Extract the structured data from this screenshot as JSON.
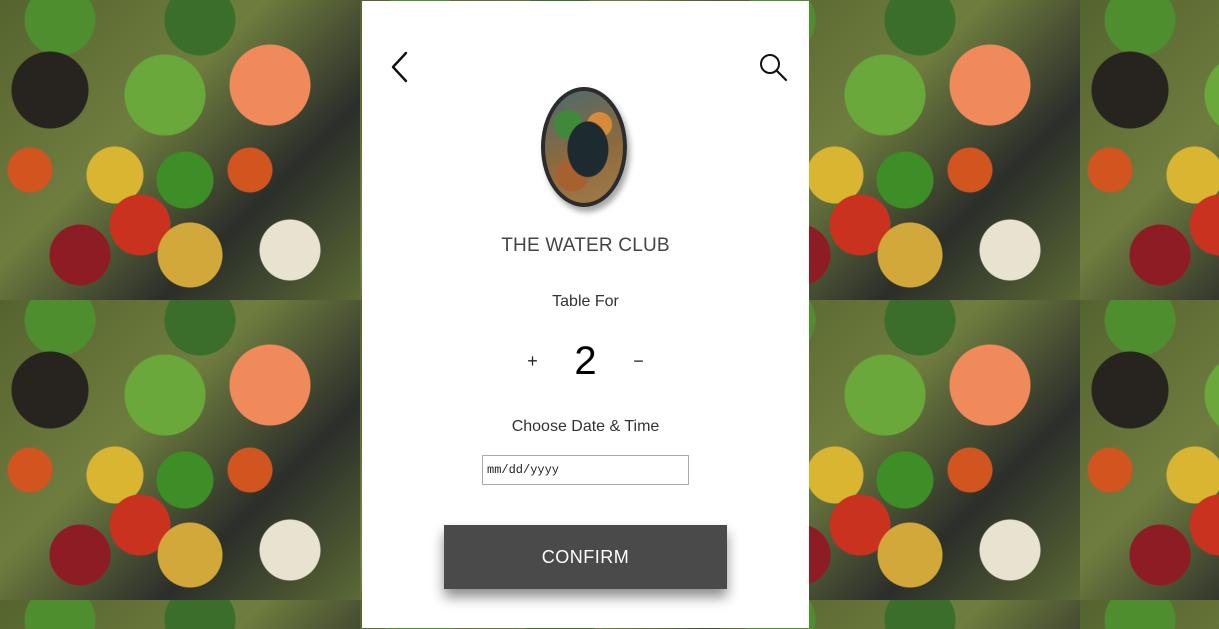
{
  "restaurant": {
    "name": "THE WATER CLUB"
  },
  "reservation": {
    "table_for_label": "Table For",
    "guest_count": "2",
    "increment_symbol": "+",
    "decrement_symbol": "−",
    "date_label": "Choose Date & Time",
    "date_placeholder": "mm/dd/yyyy"
  },
  "actions": {
    "confirm_label": "CONFIRM"
  },
  "icons": {
    "back": "chevron-left-icon",
    "search": "search-icon"
  },
  "colors": {
    "confirm_button": "#4a4a4a",
    "card": "#ffffff",
    "text": "#444444"
  }
}
